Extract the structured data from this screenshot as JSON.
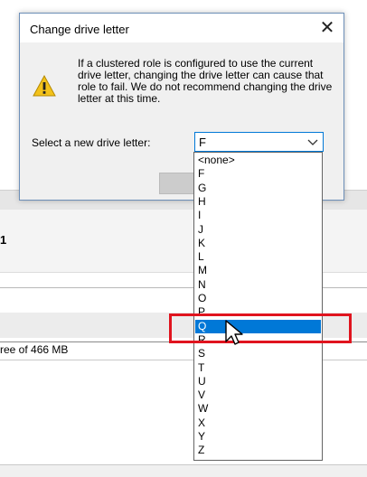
{
  "dialog": {
    "title": "Change drive letter",
    "close_glyph": "✕",
    "icon": "warning-icon",
    "message": "If a clustered role is configured to use the current drive letter, changing the drive letter can cause that role to fail. We do not recommend changing the drive letter at this time.",
    "select_label": "Select a new drive letter:",
    "selected_value": "F",
    "ok_label": ""
  },
  "dropdown": {
    "options": [
      "<none>",
      "F",
      "G",
      "H",
      "I",
      "J",
      "K",
      "L",
      "M",
      "N",
      "O",
      "P",
      "Q",
      "R",
      "S",
      "T",
      "U",
      "V",
      "W",
      "X",
      "Y",
      "Z"
    ],
    "highlighted": "Q"
  },
  "background": {
    "header_text": "1",
    "free_space_text": "ree of 466 MB"
  },
  "colors": {
    "accent": "#0078d7",
    "annotation": "#e0141e",
    "dialog_bg": "#f0f0f0",
    "dialog_border": "#6d8fb8"
  }
}
